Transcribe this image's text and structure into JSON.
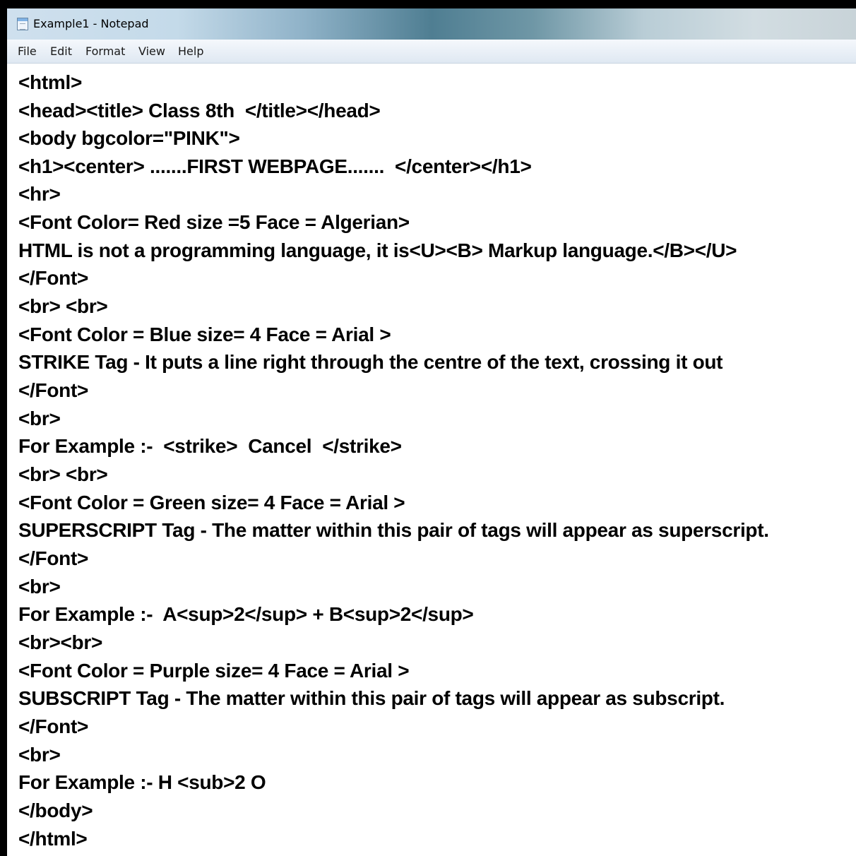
{
  "window": {
    "title": "Example1 - Notepad"
  },
  "menubar": {
    "file": "File",
    "edit": "Edit",
    "format": "Format",
    "view": "View",
    "help": "Help"
  },
  "editor": {
    "lines": [
      "<html>",
      "<head><title> Class 8th  </title></head>",
      "<body bgcolor=\"PINK\">",
      "<h1><center> .......FIRST WEBPAGE.......  </center></h1>",
      "<hr>",
      "<Font Color= Red size =5 Face = Algerian>",
      "HTML is not a programming language, it is<U><B> Markup language.</B></U>",
      "</Font>",
      "<br> <br>",
      "<Font Color = Blue size= 4 Face = Arial >",
      "STRIKE Tag - It puts a line right through the centre of the text, crossing it out",
      "</Font>",
      "<br>",
      "For Example :-  <strike>  Cancel  </strike>",
      "<br> <br>",
      "<Font Color = Green size= 4 Face = Arial >",
      "SUPERSCRIPT Tag - The matter within this pair of tags will appear as superscript.",
      "</Font>",
      "<br>",
      "For Example :-  A<sup>2</sup> + B<sup>2</sup>",
      "<br><br>",
      "<Font Color = Purple size= 4 Face = Arial >",
      "SUBSCRIPT Tag - The matter within this pair of tags will appear as subscript.",
      "</Font>",
      "<br>",
      "For Example :- H <sub>2 O",
      "</body>",
      "</html>"
    ]
  }
}
